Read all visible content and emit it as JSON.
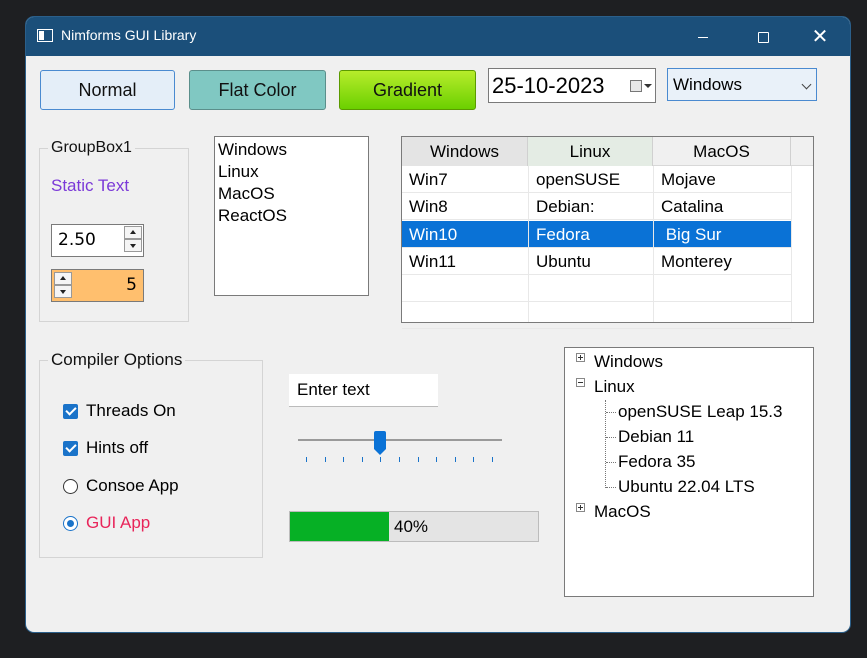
{
  "window": {
    "title": "Nimforms GUI Library"
  },
  "buttons": {
    "normal": "Normal",
    "flat": "Flat Color",
    "gradient": "Gradient"
  },
  "datepicker": {
    "value": "25-10-2023"
  },
  "combo": {
    "value": "Windows"
  },
  "groupbox1": {
    "title": "GroupBox1",
    "static_text": "Static Text",
    "spin_float": "2.50",
    "spin_int": "5"
  },
  "listbox": {
    "items": [
      "Windows",
      "Linux",
      "MacOS",
      "ReactOS"
    ]
  },
  "listview": {
    "columns": [
      "Windows",
      "Linux",
      "MacOS"
    ],
    "rows": [
      [
        "Win7",
        "openSUSE",
        "Mojave"
      ],
      [
        "Win8",
        "Debian:",
        "Catalina"
      ],
      [
        "Win10",
        "Fedora",
        " Big Sur"
      ],
      [
        "Win11",
        "Ubuntu",
        "Monterey"
      ]
    ],
    "selected_row": 2
  },
  "compiler": {
    "title": "Compiler Options",
    "options": [
      {
        "label": "Threads On",
        "type": "checkbox",
        "checked": true
      },
      {
        "label": "Hints off",
        "type": "checkbox",
        "checked": true
      },
      {
        "label": "Consoe App",
        "type": "radio",
        "checked": false
      },
      {
        "label": "GUI App",
        "type": "radio",
        "checked": true
      }
    ]
  },
  "textbox": {
    "value": "Enter text"
  },
  "slider": {
    "value": 4,
    "min": 0,
    "max": 10
  },
  "progress": {
    "value": 40,
    "label": "40%"
  },
  "treeview": {
    "nodes": [
      {
        "label": "Windows",
        "expanded": false
      },
      {
        "label": "Linux",
        "expanded": true,
        "children": [
          "openSUSE Leap 15.3",
          "Debian 11",
          "Fedora 35",
          "Ubuntu 22.04 LTS"
        ]
      },
      {
        "label": "MacOS",
        "expanded": false
      }
    ]
  },
  "colors": {
    "titlebar": "#1b4f7a",
    "accent": "#0a72d6",
    "progress": "#06b025",
    "static_text": "#7b39d8",
    "gui_app": "#e8255a",
    "spin_bg": "#ffbf6e"
  }
}
